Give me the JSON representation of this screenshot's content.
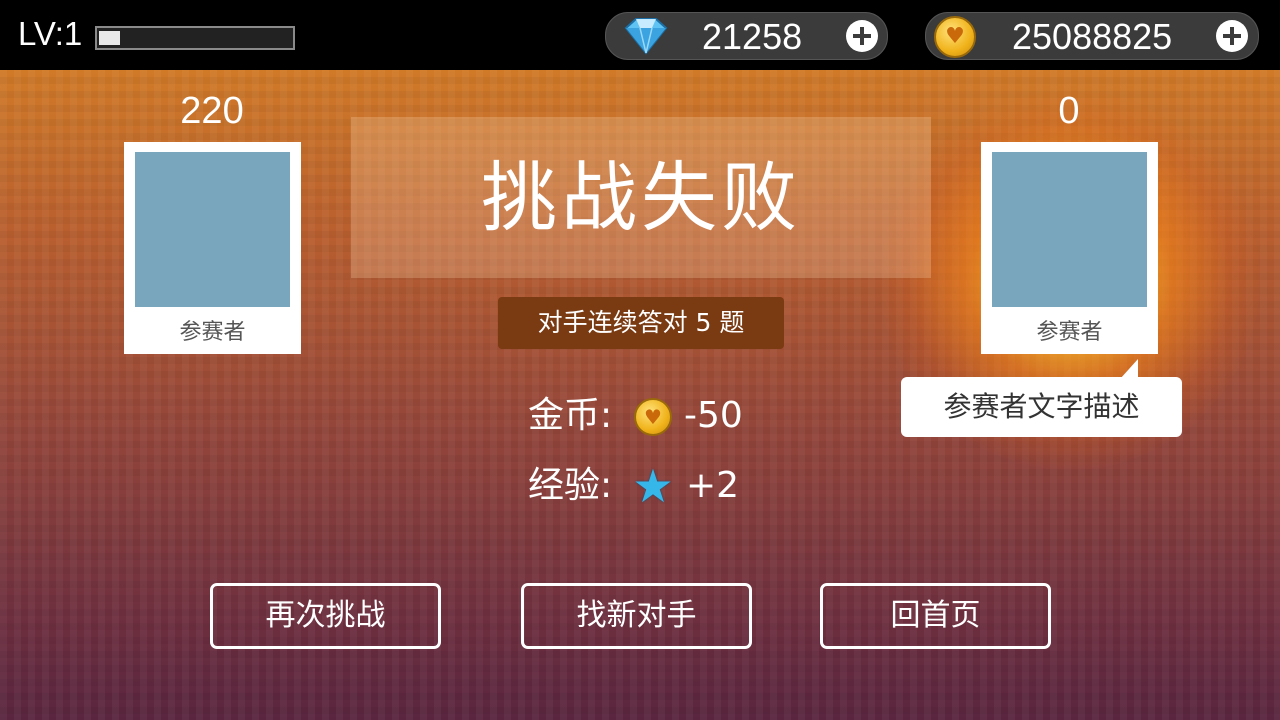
{
  "hud": {
    "level_label": "LV:1",
    "xp_progress": 0.11,
    "gems": "21258",
    "gems_icon": "diamond-icon",
    "coins": "25088825",
    "coins_icon": "gold-heart-coin-icon"
  },
  "player": {
    "score": "220",
    "name": "参赛者"
  },
  "opponent": {
    "score": "0",
    "name": "参赛者",
    "description": "参赛者文字描述"
  },
  "result": {
    "title": "挑战失败",
    "streak_text": "对手连续答对 5 题"
  },
  "rewards": {
    "coins_label": "金币:",
    "coins_value": "-50",
    "exp_label": "经验:",
    "exp_value": "+2"
  },
  "buttons": {
    "retry": "再次挑战",
    "new_opponent": "找新对手",
    "home": "回首页"
  },
  "colors": {
    "avatar_placeholder": "#7aa6bd",
    "streak_badge": "#7a3a12",
    "burst": "#ffb020"
  }
}
